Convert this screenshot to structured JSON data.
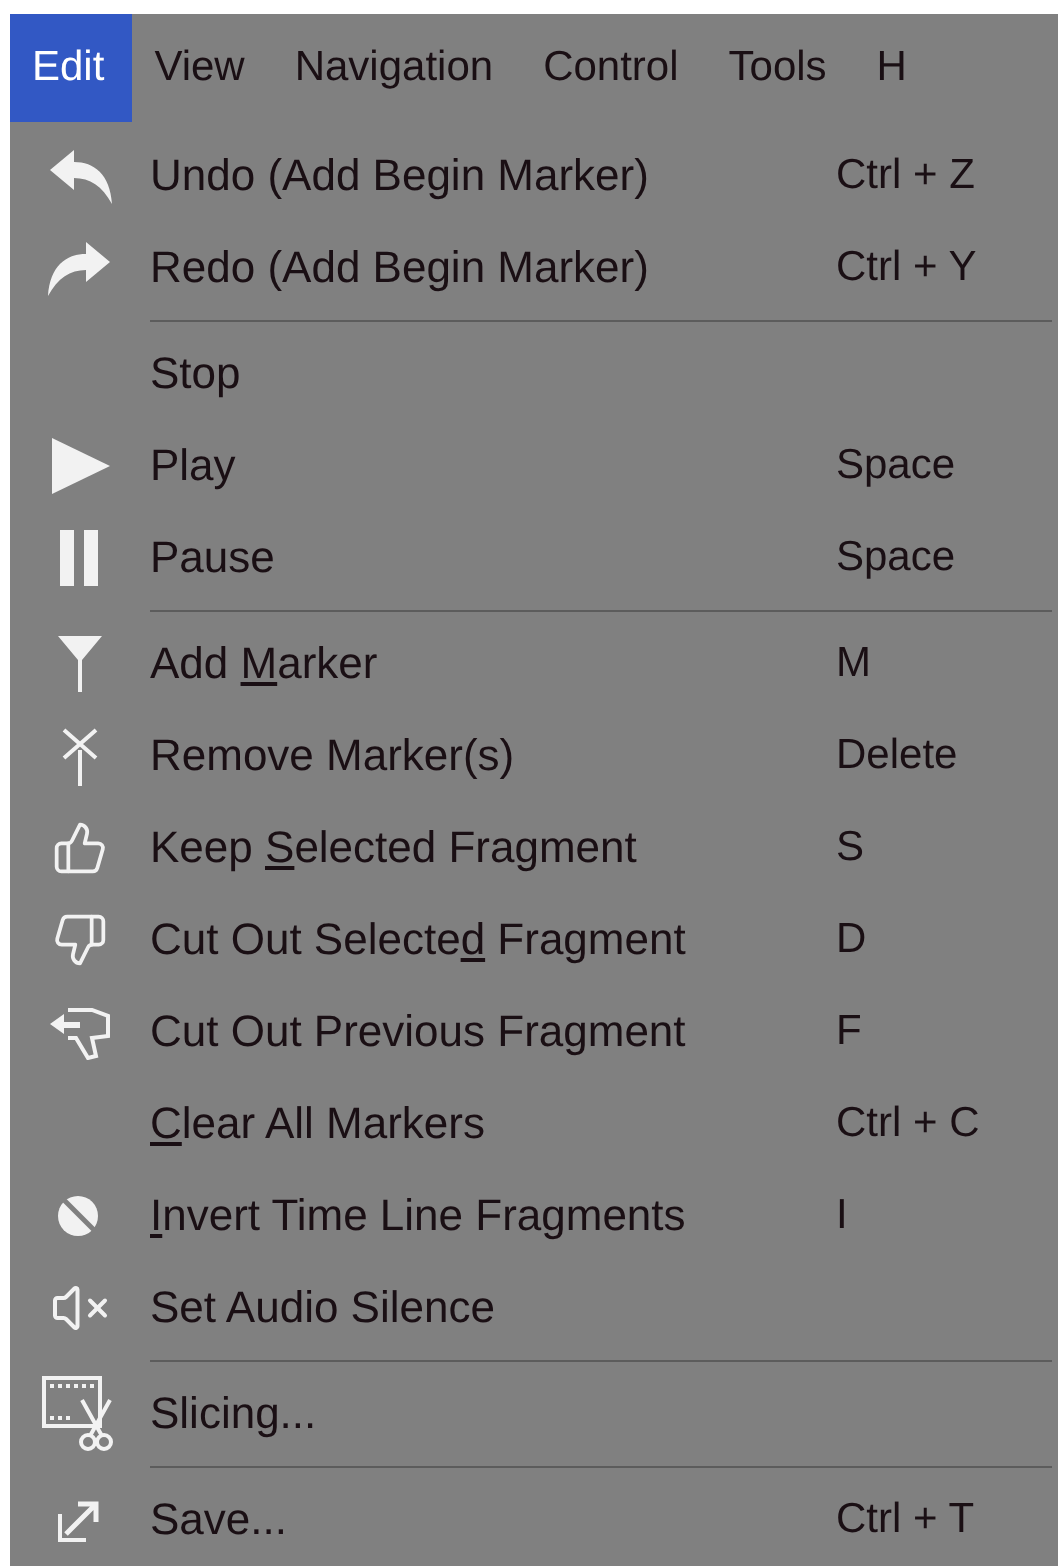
{
  "menu_bar": [
    {
      "label": "Edit",
      "selected": true
    },
    {
      "label": "View",
      "selected": false
    },
    {
      "label": "Navigation",
      "selected": false
    },
    {
      "label": "Control",
      "selected": false
    },
    {
      "label": "Tools",
      "selected": false
    },
    {
      "label": "H",
      "selected": false
    }
  ],
  "menu": [
    {
      "kind": "item",
      "label": [
        {
          "text": "Undo (Add Begin Marker)",
          "underlined": false
        }
      ],
      "shortcut": "Ctrl + Z"
    },
    {
      "kind": "item",
      "label": [
        {
          "text": "Redo (Add Begin Marker)",
          "underlined": false
        }
      ],
      "shortcut": "Ctrl + Y"
    },
    {
      "kind": "separator"
    },
    {
      "kind": "item",
      "label": [
        {
          "text": "Stop",
          "underlined": false
        }
      ]
    },
    {
      "kind": "item",
      "label": [
        {
          "text": "Play",
          "underlined": false
        }
      ],
      "shortcut": "Space"
    },
    {
      "kind": "item",
      "label": [
        {
          "text": "Pause",
          "underlined": false
        }
      ],
      "shortcut": "Space"
    },
    {
      "kind": "separator"
    },
    {
      "kind": "item",
      "label": [
        {
          "text": "Add ",
          "underlined": false
        },
        {
          "text": "M",
          "underlined": true
        },
        {
          "text": "arker",
          "underlined": false
        }
      ],
      "shortcut": "M"
    },
    {
      "kind": "item",
      "label": [
        {
          "text": "Remove Marker(s)",
          "underlined": false
        }
      ],
      "shortcut": "Delete"
    },
    {
      "kind": "item",
      "label": [
        {
          "text": "Keep ",
          "underlined": false
        },
        {
          "text": "S",
          "underlined": true
        },
        {
          "text": "elected Fragment",
          "underlined": false
        }
      ],
      "shortcut": "S"
    },
    {
      "kind": "item",
      "label": [
        {
          "text": "Cut Out Selecte",
          "underlined": false
        },
        {
          "text": "d",
          "underlined": true
        },
        {
          "text": " Fragment",
          "underlined": false
        }
      ],
      "shortcut": "D"
    },
    {
      "kind": "item",
      "label": [
        {
          "text": "Cut Out Previous Fragment",
          "underlined": false
        }
      ],
      "shortcut": "F"
    },
    {
      "kind": "item",
      "label": [
        {
          "text": "C",
          "underlined": true
        },
        {
          "text": "lear All Markers",
          "underlined": false
        }
      ],
      "shortcut": "Ctrl + C"
    },
    {
      "kind": "item",
      "label": [
        {
          "text": "I",
          "underlined": true
        },
        {
          "text": "nvert Time Line Fragments",
          "underlined": false
        }
      ],
      "shortcut": "I"
    },
    {
      "kind": "item",
      "label": [
        {
          "text": "Set Audio Silence",
          "underlined": false
        }
      ]
    },
    {
      "kind": "separator"
    },
    {
      "kind": "item",
      "label": [
        {
          "text": "Slicing...",
          "underlined": false
        }
      ]
    },
    {
      "kind": "separator"
    },
    {
      "kind": "item",
      "label": [
        {
          "text": "Save...",
          "underlined": false
        }
      ],
      "shortcut": "Ctrl + T"
    }
  ]
}
